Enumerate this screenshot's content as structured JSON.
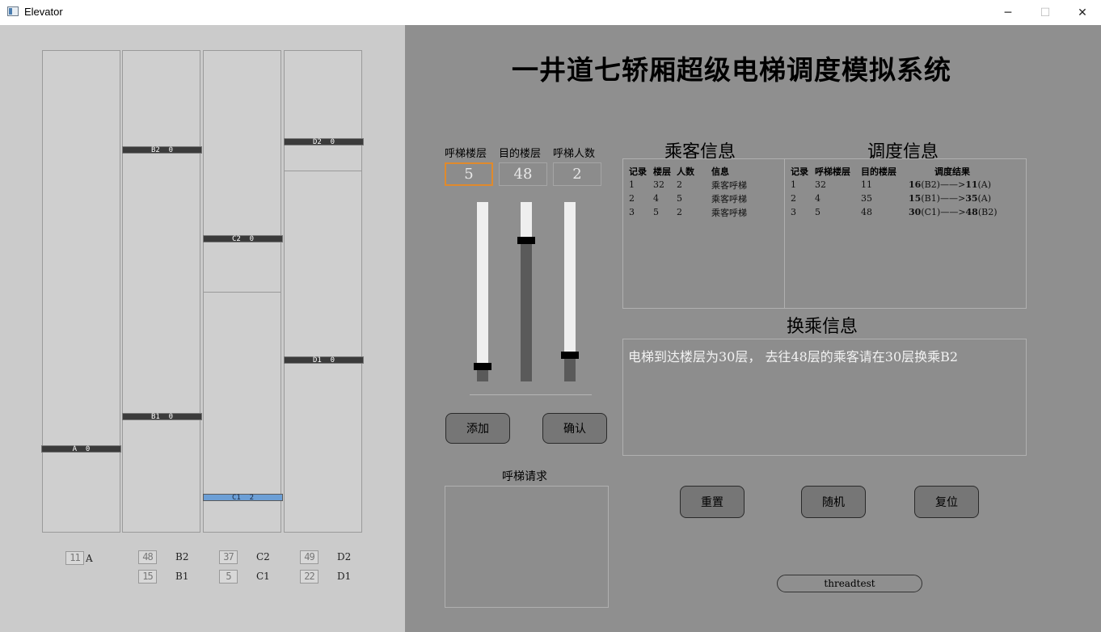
{
  "window": {
    "title": "Elevator",
    "minimize": "─",
    "maximize": "☐",
    "close": "✕"
  },
  "app_title": "一井道七轿厢超级电梯调度模拟系统",
  "elevators": {
    "cars": [
      {
        "label": "A  0",
        "floor": 16
      },
      {
        "label": "B2  0",
        "floor": 48
      },
      {
        "label": "B1  0",
        "floor": 15
      },
      {
        "label": "C2  0",
        "floor": 37
      },
      {
        "label": "C1  2",
        "floor": 5
      },
      {
        "label": "D2  0",
        "floor": 49
      },
      {
        "label": "D1  0",
        "floor": 22
      }
    ],
    "displays": [
      {
        "name": "A",
        "value": "11"
      },
      {
        "name": "B2",
        "value": "48"
      },
      {
        "name": "B1",
        "value": "15"
      },
      {
        "name": "C2",
        "value": "37"
      },
      {
        "name": "C1",
        "value": "5"
      },
      {
        "name": "D2",
        "value": "49"
      },
      {
        "name": "D1",
        "value": "22"
      }
    ]
  },
  "controls": {
    "call_floor_label": "呼梯楼层",
    "target_floor_label": "目的楼层",
    "people_label": "呼梯人数",
    "call_floor_value": "5",
    "target_floor_value": "48",
    "people_value": "2",
    "call_floor_slider": 0.06,
    "target_floor_slider": 0.8,
    "people_slider": 0.2,
    "add_button": "添加",
    "confirm_button": "确认",
    "call_requests_label": "呼梯请求"
  },
  "passenger_info": {
    "title": "乘客信息",
    "headers": [
      "记录",
      "楼层",
      "人数",
      "信息"
    ],
    "rows": [
      [
        "1",
        "32",
        "2",
        "乘客呼梯"
      ],
      [
        "2",
        "4",
        "5",
        "乘客呼梯"
      ],
      [
        "3",
        "5",
        "2",
        "乘客呼梯"
      ]
    ]
  },
  "dispatch_info": {
    "title": "调度信息",
    "headers": [
      "记录",
      "呼梯楼层",
      "目的楼层",
      "调度结果"
    ],
    "rows": [
      {
        "no": "1",
        "call": "32",
        "target": "11",
        "from": "16",
        "from_car": "(B2)",
        "arrow": "——>",
        "to": "11",
        "to_car": "(A)"
      },
      {
        "no": "2",
        "call": "4",
        "target": "35",
        "from": "15",
        "from_car": "(B1)",
        "arrow": "——>",
        "to": "35",
        "to_car": "(A)"
      },
      {
        "no": "3",
        "call": "5",
        "target": "48",
        "from": "30",
        "from_car": "(C1)",
        "arrow": "——>",
        "to": "48",
        "to_car": "(B2)"
      }
    ]
  },
  "transfer_info": {
    "title": "换乘信息",
    "text": "电梯到达楼层为30层， 去往48层的乘客请在30层换乘B2"
  },
  "actions": {
    "reset": "重置",
    "random": "随机",
    "restore": "复位",
    "threadtest": "threadtest"
  }
}
